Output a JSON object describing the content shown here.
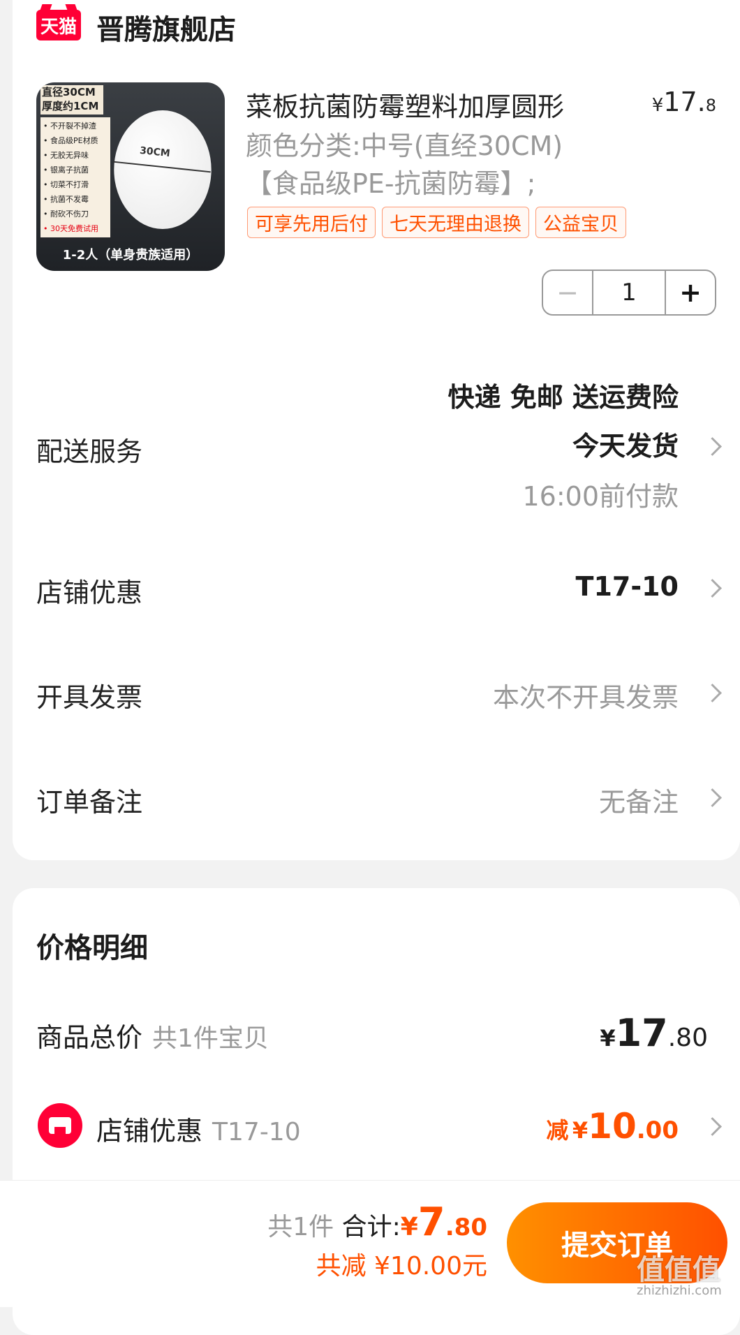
{
  "shop": {
    "logo_text": "天猫",
    "name": "晋腾旗舰店"
  },
  "product": {
    "image": {
      "spec_lines": [
        "直径30CM",
        "厚度约1CM"
      ],
      "features": [
        "• 不开裂不掉渣",
        "• 食品级PE材质",
        "• 无胶无异味",
        "• 银离子抗菌",
        "• 切菜不打滑",
        "• 抗菌不发霉",
        "• 耐砍不伤刀",
        "• 30天免费试用"
      ],
      "disc_label": "30CM",
      "bottom_text": "1-2人（单身贵族适用）"
    },
    "title": "菜板抗菌防霉塑料加厚圆形",
    "price": {
      "yen": "¥",
      "int": "17.",
      "dec": "8"
    },
    "sku_line1": "颜色分类:中号(直经30CM)",
    "sku_line2": "【食品级PE-抗菌防霉】;",
    "tags": [
      "可享先用后付",
      "七天无理由退换",
      "公益宝贝"
    ],
    "quantity": "1",
    "minus": "−",
    "plus": "+"
  },
  "delivery": {
    "label": "配送服务",
    "line1": "快递 免邮 送运费险",
    "line2": "今天发货",
    "line3": "16:00前付款"
  },
  "store_discount": {
    "label": "店铺优惠",
    "value": "T17-10"
  },
  "invoice": {
    "label": "开具发票",
    "value": "本次不开具发票"
  },
  "note": {
    "label": "订单备注",
    "value": "无备注"
  },
  "price_detail": {
    "title": "价格明细",
    "total_label": "商品总价",
    "total_sub": "共1件宝贝",
    "total_yen": "¥",
    "total_int": "17",
    "total_dec": ".80",
    "discount_label": "店铺优惠",
    "discount_sub": "T17-10",
    "discount_pre": "减",
    "discount_yen": "¥",
    "discount_int": "10",
    "discount_dec": ".00"
  },
  "footer": {
    "count": "共1件",
    "sum_label": "合计:",
    "sum_yen": "¥",
    "sum_int": "7",
    "sum_dec": ".80",
    "saved": "共减 ¥10.00元",
    "submit": "提交订单",
    "watermark": "值值值",
    "watermark_url": "zhizhizhi.com"
  },
  "colors": {
    "accent": "#ff5000",
    "tmall": "#ff0036",
    "text": "#1c1c1c",
    "muted": "#999999"
  }
}
